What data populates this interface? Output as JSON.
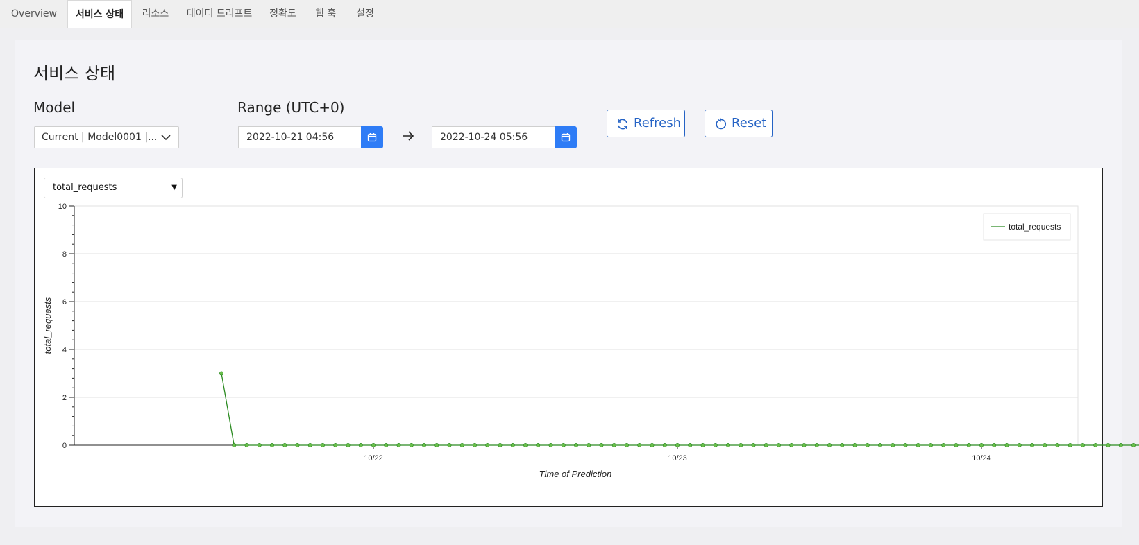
{
  "tabs": [
    {
      "label": "Overview",
      "active": false
    },
    {
      "label": "서비스 상태",
      "active": true
    },
    {
      "label": "리소스",
      "active": false
    },
    {
      "label": "데이터 드리프트",
      "active": false
    },
    {
      "label": "정확도",
      "active": false
    },
    {
      "label": "웹 훅",
      "active": false
    },
    {
      "label": "설정",
      "active": false
    }
  ],
  "page": {
    "title": "서비스 상태"
  },
  "model": {
    "label": "Model",
    "value": "Current | Model0001 |..."
  },
  "range": {
    "label": "Range (UTC+0)",
    "start": "2022-10-21 04:56",
    "end": "2022-10-24 05:56"
  },
  "buttons": {
    "refresh": "Refresh",
    "reset": "Reset"
  },
  "metric_select": {
    "value": "total_requests"
  },
  "colors": {
    "accent": "#2e7cf6",
    "button_text": "#2563c5",
    "series": "#2a8a20",
    "marker": "#6abf4b"
  },
  "icons": [
    "calendar-icon",
    "arrow-right-icon",
    "refresh-icon",
    "reset-icon",
    "chevron-down-icon"
  ],
  "chart_data": {
    "type": "line",
    "xlabel": "Time of Prediction",
    "ylabel": "total_requests",
    "ylim": [
      0,
      10
    ],
    "yticks": [
      0,
      2,
      4,
      6,
      8,
      10
    ],
    "xticks": [
      "10/22",
      "10/23",
      "10/24"
    ],
    "grid": true,
    "legend": "top-right",
    "series": [
      {
        "name": "total_requests",
        "x_start_hours_before_1022": 12,
        "x_step_hours": 1,
        "values": [
          3,
          0,
          0,
          0,
          0,
          0,
          0,
          0,
          0,
          0,
          0,
          0,
          0,
          0,
          0,
          0,
          0,
          0,
          0,
          0,
          0,
          0,
          0,
          0,
          0,
          0,
          0,
          0,
          0,
          0,
          0,
          0,
          0,
          0,
          0,
          0,
          0,
          0,
          0,
          0,
          0,
          0,
          0,
          0,
          0,
          0,
          0,
          0,
          0,
          0,
          0,
          0,
          0,
          0,
          0,
          0,
          0,
          0,
          0,
          0,
          0,
          0,
          0,
          0,
          0,
          0,
          0,
          0,
          0,
          0,
          0,
          0,
          0,
          0,
          0,
          0,
          0,
          0
        ]
      }
    ]
  }
}
